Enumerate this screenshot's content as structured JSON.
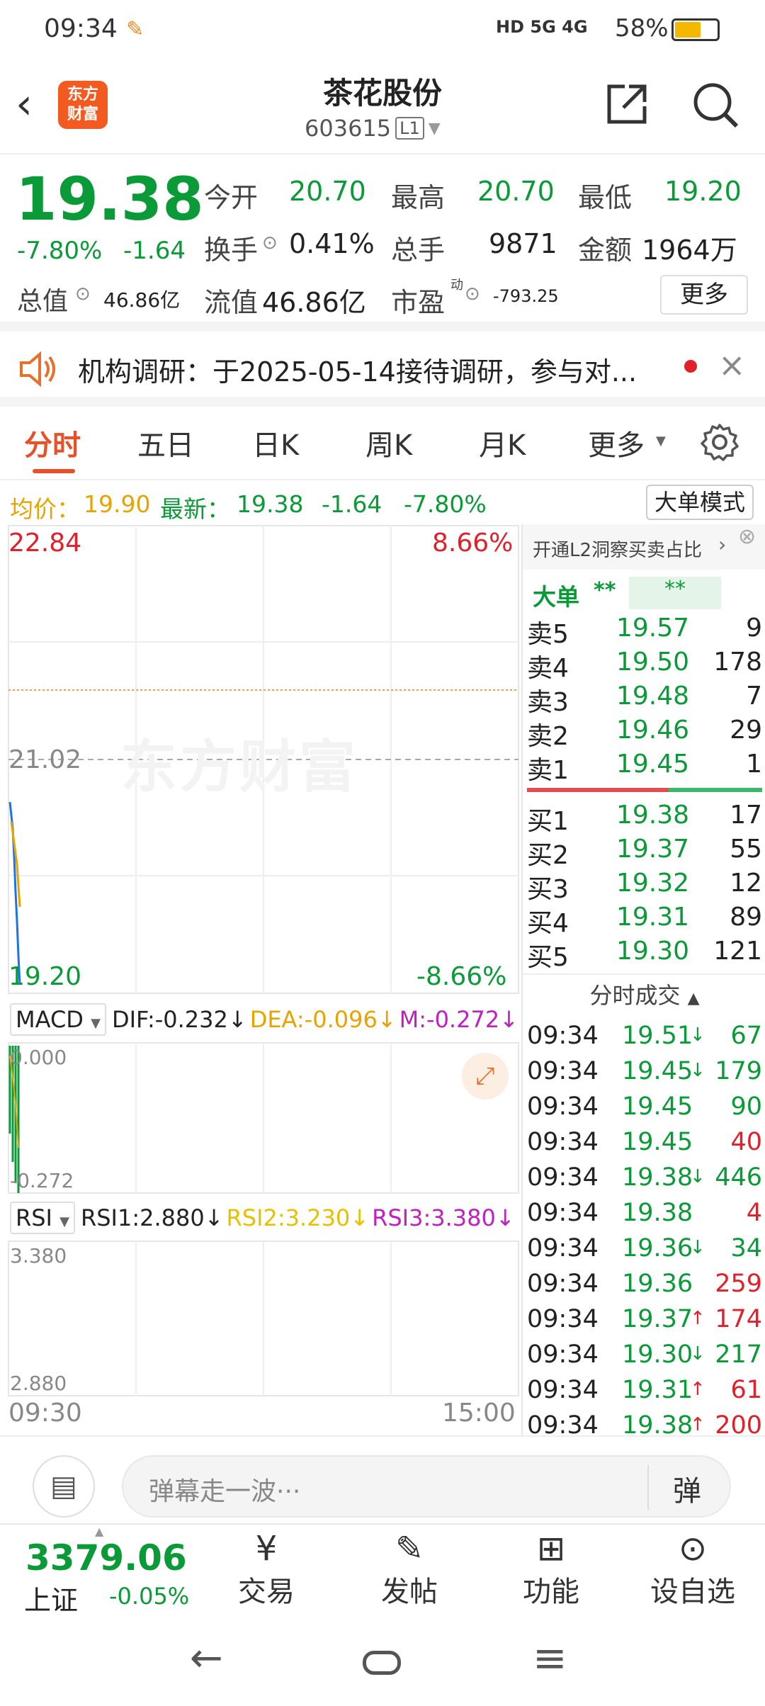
{
  "status_bar": {
    "time": "09:34",
    "network": "HD 5G 4G",
    "battery": "58%"
  },
  "header": {
    "stock_name": "茶花股份",
    "code": "603615",
    "level": "L1",
    "logo_text_1": "东方",
    "logo_text_2": "财富"
  },
  "quote": {
    "price": "19.38",
    "pct": "-7.80%",
    "chg": "-1.64",
    "open_label": "今开",
    "open": "20.70",
    "high_label": "最高",
    "high": "20.70",
    "low_label": "最低",
    "low": "19.20",
    "turnover_label": "换手",
    "turnover": "0.41%",
    "vol_label": "总手",
    "vol": "9871",
    "amount_label": "金额",
    "amount": "1964万",
    "mcap_label": "总值",
    "mcap": "46.86亿",
    "float_label": "流值",
    "float": "46.86亿",
    "pe_label": "市盈",
    "pe_sup": "动",
    "pe": "-793.25",
    "more": "更多"
  },
  "notice": {
    "text": "机构调研：于2025-05-14接待调研，参与对..."
  },
  "tabs": [
    "分时",
    "五日",
    "日K",
    "周K",
    "月K",
    "更多"
  ],
  "avg_bar": {
    "avg_label": "均价：",
    "avg": "19.90",
    "latest_label": "最新：",
    "latest": "19.38",
    "chg": "-1.64",
    "pct": "-7.80%",
    "mode_btn": "大单模式"
  },
  "chart": {
    "y_top": "22.84",
    "y_mid": "21.02",
    "y_bot": "19.20",
    "pct_top": "8.66%",
    "pct_bot": "-8.66%",
    "watermark": "东方财富",
    "macd_label": "MACD",
    "dif": "DIF:-0.232",
    "dea": "DEA:-0.096",
    "m": "M:-0.272",
    "macd_top": "0.000",
    "macd_bot": "-0.272",
    "rsi_label": "RSI",
    "rsi1": "RSI1:2.880",
    "rsi2": "RSI2:3.230",
    "rsi3": "RSI3:3.380",
    "rsi_top": "3.380",
    "rsi_bot": "2.880",
    "t_start": "09:30",
    "t_end": "15:00"
  },
  "side": {
    "promo": "开通L2洞察买卖占比",
    "big_label": "大单",
    "big_v1": "**",
    "big_v2": "**",
    "asks": [
      {
        "l": "卖5",
        "p": "19.57",
        "v": "9"
      },
      {
        "l": "卖4",
        "p": "19.50",
        "v": "178"
      },
      {
        "l": "卖3",
        "p": "19.48",
        "v": "7"
      },
      {
        "l": "卖2",
        "p": "19.46",
        "v": "29"
      },
      {
        "l": "卖1",
        "p": "19.45",
        "v": "1"
      }
    ],
    "bids": [
      {
        "l": "买1",
        "p": "19.38",
        "v": "17"
      },
      {
        "l": "买2",
        "p": "19.37",
        "v": "55"
      },
      {
        "l": "买3",
        "p": "19.32",
        "v": "12"
      },
      {
        "l": "买4",
        "p": "19.31",
        "v": "89"
      },
      {
        "l": "买5",
        "p": "19.30",
        "v": "121"
      }
    ],
    "ticks_title": "分时成交",
    "ticks": [
      {
        "t": "09:34",
        "p": "19.51",
        "a": "↓",
        "v": "67",
        "c": "g"
      },
      {
        "t": "09:34",
        "p": "19.45",
        "a": "↓",
        "v": "179",
        "c": "g"
      },
      {
        "t": "09:34",
        "p": "19.45",
        "a": "",
        "v": "90",
        "c": "g"
      },
      {
        "t": "09:34",
        "p": "19.45",
        "a": "",
        "v": "40",
        "c": "r"
      },
      {
        "t": "09:34",
        "p": "19.38",
        "a": "↓",
        "v": "446",
        "c": "g"
      },
      {
        "t": "09:34",
        "p": "19.38",
        "a": "",
        "v": "4",
        "c": "r"
      },
      {
        "t": "09:34",
        "p": "19.36",
        "a": "↓",
        "v": "34",
        "c": "g"
      },
      {
        "t": "09:34",
        "p": "19.36",
        "a": "",
        "v": "259",
        "c": "r"
      },
      {
        "t": "09:34",
        "p": "19.37",
        "a": "↑",
        "v": "174",
        "c": "r"
      },
      {
        "t": "09:34",
        "p": "19.30",
        "a": "↓",
        "v": "217",
        "c": "g"
      },
      {
        "t": "09:34",
        "p": "19.31",
        "a": "↑",
        "v": "61",
        "c": "r"
      },
      {
        "t": "09:34",
        "p": "19.38",
        "a": "↑",
        "v": "200",
        "c": "r"
      }
    ]
  },
  "comment": {
    "placeholder": "弹幕走一波···",
    "danmu": "弹"
  },
  "bottom": {
    "index": "3379.06",
    "index_name": "上证",
    "index_pct": "-0.05%",
    "trade": "交易",
    "post": "发帖",
    "func": "功能",
    "fav": "设自选"
  }
}
